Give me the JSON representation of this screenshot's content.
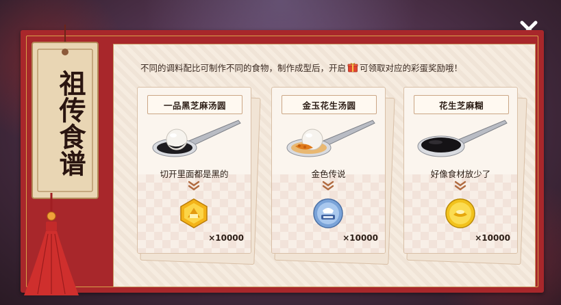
{
  "panel": {
    "header_before": "不同的调料配比可制作不同的食物，制作成型后，开启",
    "header_after": "可领取对应的彩蛋奖励哦！"
  },
  "tag": {
    "title": "祖传食谱"
  },
  "recipes": [
    {
      "title": "一品黑芝麻汤圆",
      "description": "切开里面都是黑的",
      "reward_qty": "×10000",
      "reward_icon": "gold-hexagon-medal-icon"
    },
    {
      "title": "金玉花生汤圆",
      "description": "金色传说",
      "reward_qty": "×10000",
      "reward_icon": "blue-badge-coin-icon"
    },
    {
      "title": "花生芝麻糊",
      "description": "好像食材放少了",
      "reward_qty": "×10000",
      "reward_icon": "gold-coin-icon"
    }
  ],
  "colors": {
    "frame_red": "#a8272b",
    "panel_bg": "#f6ece0",
    "text_dark": "#2b1d15",
    "chevron": "#b06a3f"
  }
}
